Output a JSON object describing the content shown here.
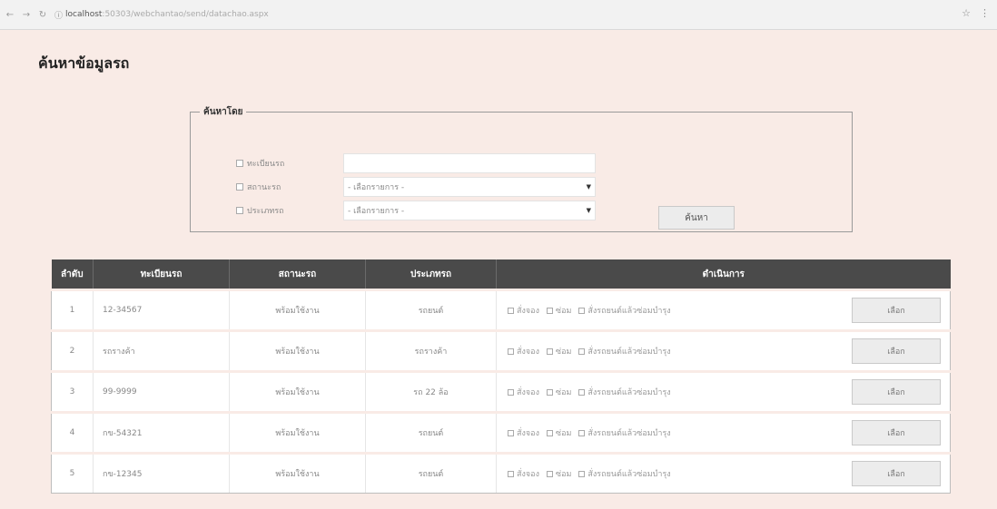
{
  "browser": {
    "url_domain": "localhost",
    "url_path": ":50303/webchantao/send/datachao.aspx"
  },
  "page": {
    "title": "ค้นหาข้อมูลรถ"
  },
  "search": {
    "legend": "ค้นหาโดย",
    "fields": [
      {
        "label": "ทะเบียนรถ"
      },
      {
        "label": "สถานะรถ",
        "selected": "- เลือกรายการ -"
      },
      {
        "label": "ประเภทรถ",
        "selected": "- เลือกรายการ -"
      }
    ],
    "button": "ค้นหา"
  },
  "table": {
    "headers": [
      "ลำดับ",
      "ทะเบียนรถ",
      "สถานะรถ",
      "ประเภทรถ",
      "ดำเนินการ"
    ],
    "option_labels": [
      "สั่งจอง",
      "ซ่อม",
      "สั่งรถยนต์แล้วซ่อมบำรุง"
    ],
    "select_label": "เลือก",
    "rows": [
      {
        "no": "1",
        "plate": "12-34567",
        "status": "พร้อมใช้งาน",
        "type": "รถยนต์"
      },
      {
        "no": "2",
        "plate": "รถรางค้า",
        "status": "พร้อมใช้งาน",
        "type": "รถรางค้า"
      },
      {
        "no": "3",
        "plate": "99-9999",
        "status": "พร้อมใช้งาน",
        "type": "รถ 22 ล้อ"
      },
      {
        "no": "4",
        "plate": "กข-54321",
        "status": "พร้อมใช้งาน",
        "type": "รถยนต์"
      },
      {
        "no": "5",
        "plate": "กข-12345",
        "status": "พร้อมใช้งาน",
        "type": "รถยนต์"
      }
    ]
  }
}
